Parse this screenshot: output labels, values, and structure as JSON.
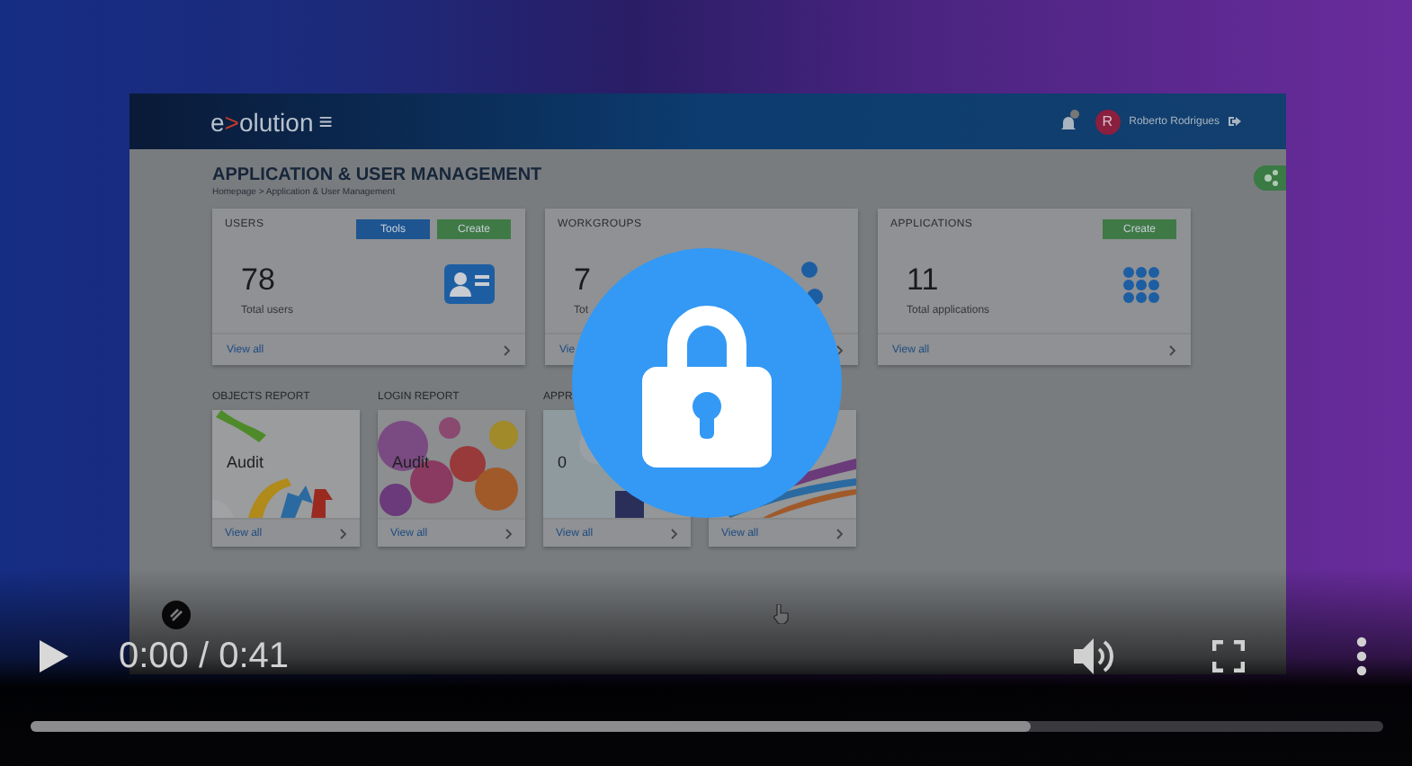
{
  "app": {
    "logo": {
      "start": "e",
      "accent": ">",
      "end": "olution"
    },
    "menu": "≡",
    "user": {
      "initial": "R",
      "name": "Roberto Rodrigues"
    },
    "title": "APPLICATION & USER MANAGEMENT",
    "breadcrumb": "Homepage > Application & User Management",
    "cards": [
      {
        "title": "USERS",
        "buttons": [
          {
            "label": "Tools",
            "kind": "primary"
          },
          {
            "label": "Create",
            "kind": "success"
          }
        ],
        "count": "78",
        "caption": "Total users",
        "link": "View all"
      },
      {
        "title": "WORKGROUPS",
        "count": "7",
        "caption": "Tot",
        "link": "Vie"
      },
      {
        "title": "APPLICATIONS",
        "buttons": [
          {
            "label": "Create",
            "kind": "success"
          }
        ],
        "count": "11",
        "caption": "Total applications",
        "link": "View all"
      }
    ],
    "reports": [
      {
        "title": "OBJECTS REPORT",
        "overlay": "Audit",
        "link": "View all"
      },
      {
        "title": "LOGIN REPORT",
        "overlay": "Audit",
        "link": "View all"
      },
      {
        "title": "APPR",
        "overlay": "0",
        "link": "View all"
      },
      {
        "link": "View all"
      }
    ]
  },
  "player": {
    "time": "0:00 / 0:41",
    "progress": {
      "level": 0.74
    }
  }
}
